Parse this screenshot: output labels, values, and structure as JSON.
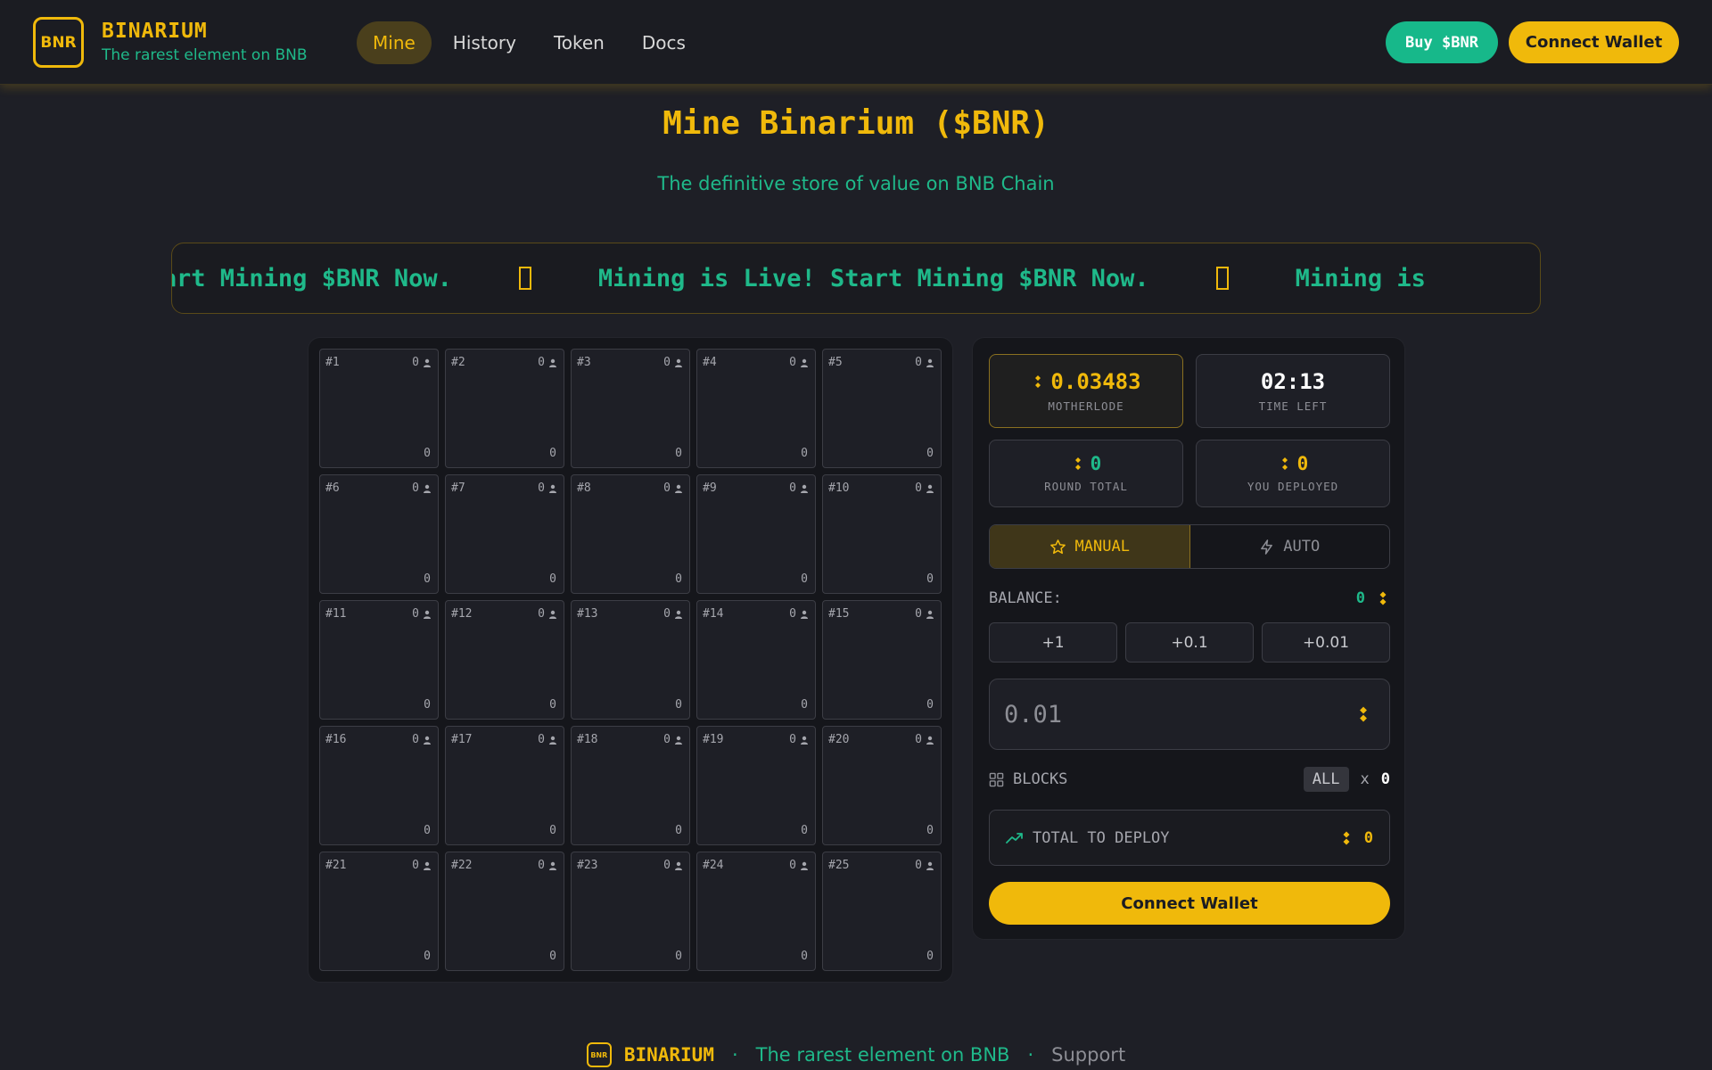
{
  "brand": {
    "logo_text": "BNR",
    "name": "BINARIUM",
    "tagline": "The rarest element on BNB"
  },
  "nav": {
    "items": [
      {
        "label": "Mine",
        "active": true
      },
      {
        "label": "History",
        "active": false
      },
      {
        "label": "Token",
        "active": false
      },
      {
        "label": "Docs",
        "active": false
      }
    ]
  },
  "header_buttons": {
    "buy_label": "Buy $BNR",
    "connect_label": "Connect Wallet"
  },
  "hero": {
    "title": "Mine Binarium ($BNR)",
    "subtitle": "The definitive store of value on BNB Chain"
  },
  "ticker": {
    "segments": [
      "ive! Start Mining $BNR Now.",
      "Mining is Live! Start Mining $BNR Now.",
      "Mining is"
    ]
  },
  "grid": {
    "cells": [
      {
        "id": "#1",
        "miners": "0",
        "amount": "0"
      },
      {
        "id": "#2",
        "miners": "0",
        "amount": "0"
      },
      {
        "id": "#3",
        "miners": "0",
        "amount": "0"
      },
      {
        "id": "#4",
        "miners": "0",
        "amount": "0"
      },
      {
        "id": "#5",
        "miners": "0",
        "amount": "0"
      },
      {
        "id": "#6",
        "miners": "0",
        "amount": "0"
      },
      {
        "id": "#7",
        "miners": "0",
        "amount": "0"
      },
      {
        "id": "#8",
        "miners": "0",
        "amount": "0"
      },
      {
        "id": "#9",
        "miners": "0",
        "amount": "0"
      },
      {
        "id": "#10",
        "miners": "0",
        "amount": "0"
      },
      {
        "id": "#11",
        "miners": "0",
        "amount": "0"
      },
      {
        "id": "#12",
        "miners": "0",
        "amount": "0"
      },
      {
        "id": "#13",
        "miners": "0",
        "amount": "0"
      },
      {
        "id": "#14",
        "miners": "0",
        "amount": "0"
      },
      {
        "id": "#15",
        "miners": "0",
        "amount": "0"
      },
      {
        "id": "#16",
        "miners": "0",
        "amount": "0"
      },
      {
        "id": "#17",
        "miners": "0",
        "amount": "0"
      },
      {
        "id": "#18",
        "miners": "0",
        "amount": "0"
      },
      {
        "id": "#19",
        "miners": "0",
        "amount": "0"
      },
      {
        "id": "#20",
        "miners": "0",
        "amount": "0"
      },
      {
        "id": "#21",
        "miners": "0",
        "amount": "0"
      },
      {
        "id": "#22",
        "miners": "0",
        "amount": "0"
      },
      {
        "id": "#23",
        "miners": "0",
        "amount": "0"
      },
      {
        "id": "#24",
        "miners": "0",
        "amount": "0"
      },
      {
        "id": "#25",
        "miners": "0",
        "amount": "0"
      }
    ]
  },
  "stats": {
    "motherlode": {
      "value": "0.03483",
      "label": "MOTHERLODE"
    },
    "time_left": {
      "value": "02:13",
      "label": "TIME LEFT"
    },
    "round_total": {
      "value": "0",
      "label": "ROUND TOTAL"
    },
    "you_deployed": {
      "value": "0",
      "label": "YOU DEPLOYED"
    }
  },
  "mode": {
    "manual_label": "MANUAL",
    "auto_label": "AUTO",
    "selected": "MANUAL"
  },
  "balance": {
    "label": "BALANCE:",
    "value": "0"
  },
  "increments": [
    "+1",
    "+0.1",
    "+0.01"
  ],
  "amount_input": {
    "placeholder": "0.01",
    "value": ""
  },
  "blocks": {
    "label": "BLOCKS",
    "all_label": "ALL",
    "multiplier": "x",
    "count": "0"
  },
  "deploy": {
    "label": "TOTAL TO DEPLOY",
    "value": "0"
  },
  "main_button": {
    "label": "Connect Wallet"
  },
  "footer": {
    "brand": "BINARIUM",
    "logo_text": "BNR",
    "separator": "·",
    "tagline": "The rarest element on BNB",
    "support": "Support"
  },
  "colors": {
    "accent_gold": "#f0b90b",
    "accent_green": "#1fb98a",
    "background": "#1e1f26"
  },
  "icons": [
    "bnb-icon",
    "person-icon",
    "star-icon",
    "bolt-icon",
    "grid-icon",
    "trend-up-icon"
  ]
}
